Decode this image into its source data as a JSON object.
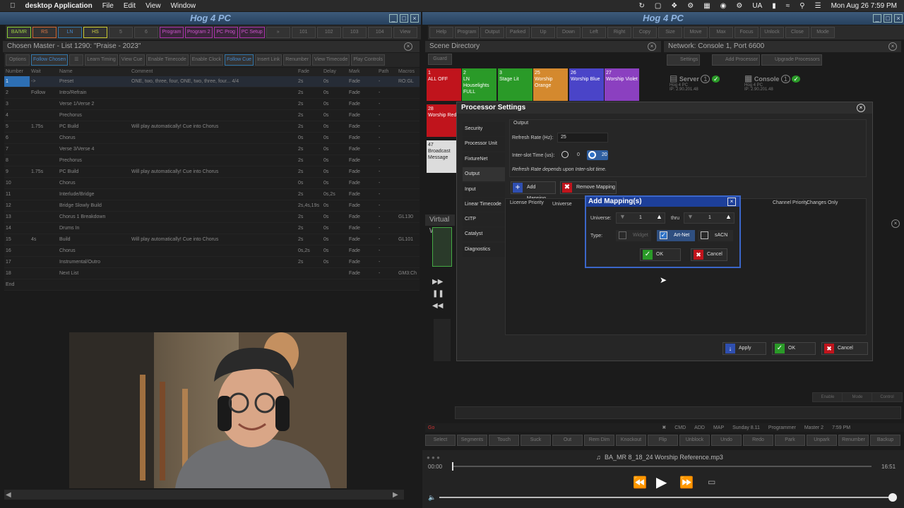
{
  "menubar": {
    "app_name": "desktop Application",
    "menus": [
      "File",
      "Edit",
      "View",
      "Window"
    ],
    "locale": "UA",
    "clock": "Mon Aug 26  7:59 PM"
  },
  "left_window": {
    "title": "Hog 4 PC",
    "toolbar_buttons": [
      "BA/MR",
      "RS",
      "LN",
      "HS",
      "5",
      "6",
      "Program",
      "Program 2",
      "PC Prog",
      "PC Setup",
      "»",
      "101",
      "102",
      "103",
      "104",
      "View"
    ],
    "panel_title": "Chosen Master - List 1290: \"Praise - 2023\"",
    "cue_toolbar": [
      "Options",
      "Follow Chosen",
      "Learn Timing",
      "View Cue",
      "Enable Timecode",
      "Enable Clock",
      "Follow Cue",
      "Insert Link",
      "Renumber",
      "View Timecode",
      "Play Controls"
    ],
    "columns": [
      "Number",
      "Wait",
      "Name",
      "Comment",
      "Fade",
      "Delay",
      "Mark",
      "Path",
      "Macros"
    ],
    "rows": [
      {
        "num": "1",
        "wait": "->",
        "name": "Preset",
        "comment": "ONE, two, three, four, ONE, two, three, four... 4/4",
        "fade": "2s",
        "delay": "0s",
        "mark": "Fade",
        "path": "-",
        "macro": "RO:GL"
      },
      {
        "num": "2",
        "wait": "Follow",
        "name": "Intro/Refrain",
        "comment": "",
        "fade": "2s",
        "delay": "0s",
        "mark": "Fade",
        "path": "-",
        "macro": ""
      },
      {
        "num": "3",
        "wait": "",
        "name": "Verse 1/Verse 2",
        "comment": "",
        "fade": "2s",
        "delay": "0s",
        "mark": "Fade",
        "path": "-",
        "macro": ""
      },
      {
        "num": "4",
        "wait": "",
        "name": "Prechorus",
        "comment": "",
        "fade": "2s",
        "delay": "0s",
        "mark": "Fade",
        "path": "-",
        "macro": ""
      },
      {
        "num": "5",
        "wait": "1.75s",
        "name": "PC Build",
        "comment": "Will play automatically! Cue into Chorus",
        "fade": "2s",
        "delay": "0s",
        "mark": "Fade",
        "path": "-",
        "macro": ""
      },
      {
        "num": "6",
        "wait": "",
        "name": "Chorus",
        "comment": "",
        "fade": "0s",
        "delay": "0s",
        "mark": "Fade",
        "path": "-",
        "macro": ""
      },
      {
        "num": "7",
        "wait": "",
        "name": "Verse 3/Verse 4",
        "comment": "",
        "fade": "2s",
        "delay": "0s",
        "mark": "Fade",
        "path": "-",
        "macro": ""
      },
      {
        "num": "8",
        "wait": "",
        "name": "Prechorus",
        "comment": "",
        "fade": "2s",
        "delay": "0s",
        "mark": "Fade",
        "path": "-",
        "macro": ""
      },
      {
        "num": "9",
        "wait": "1.75s",
        "name": "PC Build",
        "comment": "Will play automatically! Cue into Chorus",
        "fade": "2s",
        "delay": "0s",
        "mark": "Fade",
        "path": "-",
        "macro": ""
      },
      {
        "num": "10",
        "wait": "",
        "name": "Chorus",
        "comment": "",
        "fade": "0s",
        "delay": "0s",
        "mark": "Fade",
        "path": "-",
        "macro": ""
      },
      {
        "num": "11",
        "wait": "",
        "name": "Interlude/Bridge",
        "comment": "",
        "fade": "2s",
        "delay": "0s,2s",
        "mark": "Fade",
        "path": "-",
        "macro": ""
      },
      {
        "num": "12",
        "wait": "",
        "name": "Bridge Slowly Build",
        "comment": "",
        "fade": "2s,4s,19s",
        "delay": "0s",
        "mark": "Fade",
        "path": "-",
        "macro": ""
      },
      {
        "num": "13",
        "wait": "",
        "name": "Chorus 1 Breakdown",
        "comment": "",
        "fade": "2s",
        "delay": "0s",
        "mark": "Fade",
        "path": "-",
        "macro": "GL130"
      },
      {
        "num": "14",
        "wait": "",
        "name": "Drums In",
        "comment": "",
        "fade": "2s",
        "delay": "0s",
        "mark": "Fade",
        "path": "-",
        "macro": ""
      },
      {
        "num": "15",
        "wait": "4s",
        "name": "Build",
        "comment": "Will play automatically! Cue into Chorus",
        "fade": "2s",
        "delay": "0s",
        "mark": "Fade",
        "path": "-",
        "macro": "GL101"
      },
      {
        "num": "16",
        "wait": "",
        "name": "Chorus",
        "comment": "",
        "fade": "0s,2s",
        "delay": "0s",
        "mark": "Fade",
        "path": "-",
        "macro": ""
      },
      {
        "num": "17",
        "wait": "",
        "name": "Instrumental/Outro",
        "comment": "",
        "fade": "2s",
        "delay": "0s",
        "mark": "Fade",
        "path": "-",
        "macro": ""
      },
      {
        "num": "18",
        "wait": "",
        "name": "Next List",
        "comment": "",
        "fade": "",
        "delay": "",
        "mark": "Fade",
        "path": "-",
        "macro": "GM3:Ch"
      },
      {
        "num": "End",
        "wait": "",
        "name": "",
        "comment": "",
        "fade": "",
        "delay": "",
        "mark": "",
        "path": "",
        "macro": ""
      }
    ]
  },
  "right_window": {
    "title": "Hog 4 PC",
    "toolbar_buttons": [
      "Help",
      "Program",
      "Output",
      "Parked",
      "Up",
      "Down",
      "Left",
      "Right",
      "Copy",
      "Size",
      "Move",
      "Max",
      "Focus",
      "Unlock",
      "Close",
      "Mode"
    ],
    "scene_directory": {
      "title": "Scene Directory",
      "guard_label": "Guard",
      "scenes": [
        {
          "num": "1",
          "label": "ALL OFF",
          "color": "#c0141c"
        },
        {
          "num": "2",
          "label": "LN Houselights FULL",
          "color": "#2a9a28"
        },
        {
          "num": "3",
          "label": "Stage Lit",
          "color": "#2a9a28"
        },
        {
          "num": "25",
          "label": "Worship Orange",
          "color": "#d4892e"
        },
        {
          "num": "26",
          "label": "Worship Blue",
          "color": "#4a44c8"
        },
        {
          "num": "27",
          "label": "Worship Violet",
          "color": "#8b40c0"
        },
        {
          "num": "28",
          "label": "Worship Red",
          "color": "#c0141c"
        },
        {
          "num": "47",
          "label": "Broadcast Message",
          "color": "#dcdcdc"
        }
      ]
    },
    "network": {
      "title": "Network: Console 1, Port 6600",
      "buttons": [
        "Settings",
        "Add Processor",
        "Upgrade Processors"
      ],
      "nodes": [
        {
          "name": "Server",
          "num": "1",
          "sub": "Hog 4 PC",
          "ip": "IP: 2.90.201.48"
        },
        {
          "name": "Console",
          "num": "1",
          "sub": "Hog 4 PC",
          "ip": "IP: 2.90.201.48"
        }
      ]
    },
    "virtual_label": "Virtual W",
    "lower_buttons": [
      "Enable",
      "Mode",
      "Control"
    ],
    "status": {
      "items": [
        "CMD",
        "ADD",
        "MAP",
        "Sunday 8.11",
        "Programmer",
        "Master 2",
        "7:59 PM"
      ],
      "left": "Go"
    },
    "bottom_keys": [
      "Select",
      "Segments",
      "Touch",
      "Suck",
      "Out",
      "Rem Dim",
      "Knockout",
      "Flip",
      "Unblock",
      "Undo",
      "Redo",
      "Park",
      "Unpark",
      "Renumber",
      "Backup"
    ]
  },
  "processor_dialog": {
    "title": "Processor Settings",
    "nav": [
      "Security",
      "Processor Unit",
      "FixtureNet",
      "Output",
      "Input",
      "Linear Timecode",
      "CITP",
      "Catalyst",
      "Diagnostics"
    ],
    "selected_nav": "Output",
    "section": "Output",
    "refresh_label": "Refresh Rate (Hz):",
    "refresh_value": "25",
    "interslot_label": "Inter-slot Time (us):",
    "interslot_options": [
      "0",
      "20"
    ],
    "interslot_selected": "20",
    "note": "Refresh Rate depends upon Inter-slot time.",
    "add_mapping": "Add Mapping",
    "remove_mapping": "Remove Mapping",
    "table_headers": [
      "License Priority",
      "Universe",
      "Channel Priority",
      "Changes Only"
    ],
    "apply": "Apply",
    "ok": "OK",
    "cancel": "Cancel"
  },
  "add_mapping_dialog": {
    "title": "Add Mapping(s)",
    "universe_label": "Universe:",
    "universe_from": "1",
    "thru_label": "thru",
    "universe_to": "1",
    "type_label": "Type:",
    "types": [
      {
        "label": "Widget",
        "checked": false,
        "disabled": true
      },
      {
        "label": "Art-Net",
        "checked": true,
        "disabled": false
      },
      {
        "label": "sACN",
        "checked": false,
        "disabled": false
      }
    ],
    "ok": "OK",
    "cancel": "Cancel"
  },
  "media_player": {
    "filename": "BA_MR 8_18_24 Worship Reference.mp3",
    "elapsed": "00:00",
    "duration": "16:51",
    "progress": 0.0
  }
}
